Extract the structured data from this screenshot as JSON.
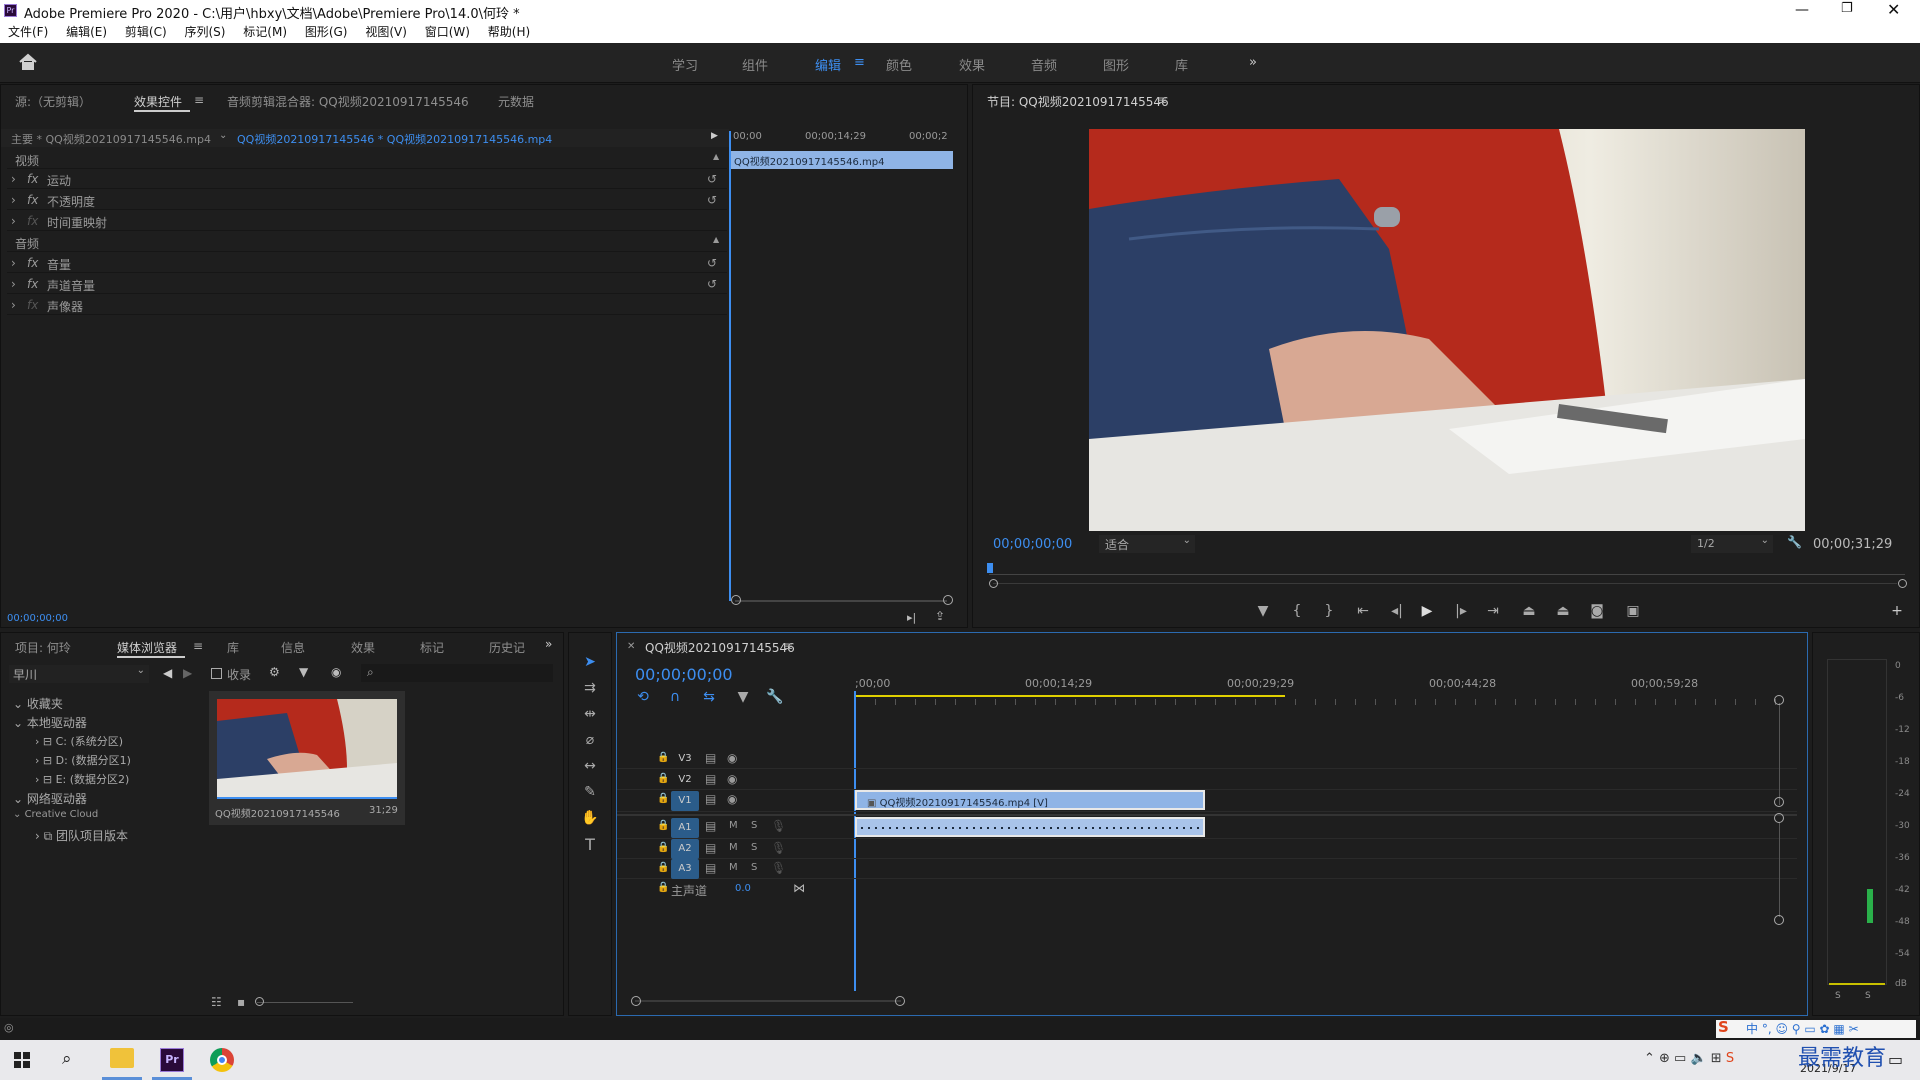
{
  "window": {
    "title": "Adobe Premiere Pro 2020 - C:\\用户\\hbxy\\文档\\Adobe\\Premiere Pro\\14.0\\何玲 *"
  },
  "menu": [
    "文件(F)",
    "编辑(E)",
    "剪辑(C)",
    "序列(S)",
    "标记(M)",
    "图形(G)",
    "视图(V)",
    "窗口(W)",
    "帮助(H)"
  ],
  "workspaces": [
    "学习",
    "组件",
    "编辑",
    "颜色",
    "效果",
    "音频",
    "图形",
    "库"
  ],
  "workspace_active": "编辑",
  "source_panel": {
    "tabs": [
      "源:（无剪辑）",
      "效果控件",
      "音频剪辑混合器: QQ视频20210917145546",
      "元数据"
    ],
    "active_tab": "效果控件",
    "master_clip": "主要 * QQ视频20210917145546.mp4",
    "sequence_clip": "QQ视频20210917145546 * QQ视频20210917145546.mp4",
    "ruler_labels": [
      "00;00",
      "00;00;14;29",
      "00;00;2"
    ],
    "clip_bar": "QQ视频20210917145546.mp4",
    "sections": [
      {
        "title": "视频",
        "items": [
          {
            "fx": "fx",
            "name": "运动"
          },
          {
            "fx": "fx",
            "name": "不透明度"
          },
          {
            "fx": "fx",
            "name": "时间重映射"
          }
        ]
      },
      {
        "title": "音频",
        "items": [
          {
            "fx": "fx",
            "name": "音量"
          },
          {
            "fx": "fx",
            "name": "声道音量"
          },
          {
            "fx": "fx",
            "name": "声像器"
          }
        ]
      }
    ],
    "timecode": "00;00;00;00"
  },
  "program_monitor": {
    "title": "节目: QQ视频20210917145546",
    "timecode": "00;00;00;00",
    "fit": "适合",
    "resolution": "1/2",
    "duration": "00;00;31;29"
  },
  "project_panel": {
    "tabs": [
      "项目: 何玲",
      "媒体浏览器",
      "库",
      "信息",
      "效果",
      "标记",
      "历史记"
    ],
    "active_tab": "媒体浏览器",
    "location": "早川",
    "ingest_label": "收录",
    "tree": [
      {
        "label": "收藏夹",
        "level": 0
      },
      {
        "label": "本地驱动器",
        "level": 0
      },
      {
        "label": "C: (系统分区)",
        "level": 1
      },
      {
        "label": "D: (数据分区1)",
        "level": 1
      },
      {
        "label": "E: (数据分区2)",
        "level": 1
      },
      {
        "label": "网络驱动器",
        "level": 0
      },
      {
        "label": "Creative Cloud",
        "level": 0
      },
      {
        "label": "团队项目版本",
        "level": 1
      }
    ],
    "thumb_name": "QQ视频20210917145546",
    "thumb_duration": "31;29"
  },
  "timeline": {
    "tab": "QQ视频20210917145546",
    "timecode": "00;00;00;00",
    "ruler": [
      ";00;00",
      "00;00;14;29",
      "00;00;29;29",
      "00;00;44;28",
      "00;00;59;28"
    ],
    "video_tracks": [
      "V3",
      "V2",
      "V1"
    ],
    "audio_tracks": [
      "A1",
      "A2",
      "A3"
    ],
    "master_label": "主声道",
    "master_value": "0.0",
    "clip_video": "QQ视频20210917145546.mp4 [V]",
    "mute": "M",
    "solo": "S"
  },
  "meter": {
    "scale": [
      "0",
      "-6",
      "-12",
      "-18",
      "-24",
      "-30",
      "-36",
      "-42",
      "-48",
      "-54",
      "dB"
    ],
    "solo": "S"
  },
  "taskbar": {
    "time": "2021/9/17",
    "ime": "中",
    "watermark": "最需教育"
  },
  "colors": {
    "accent": "#3d8ef0",
    "clip_video": "#8fb4e6",
    "clip_audio": "#a9c4ea",
    "tab_active_bg": "#2b5c8a"
  }
}
